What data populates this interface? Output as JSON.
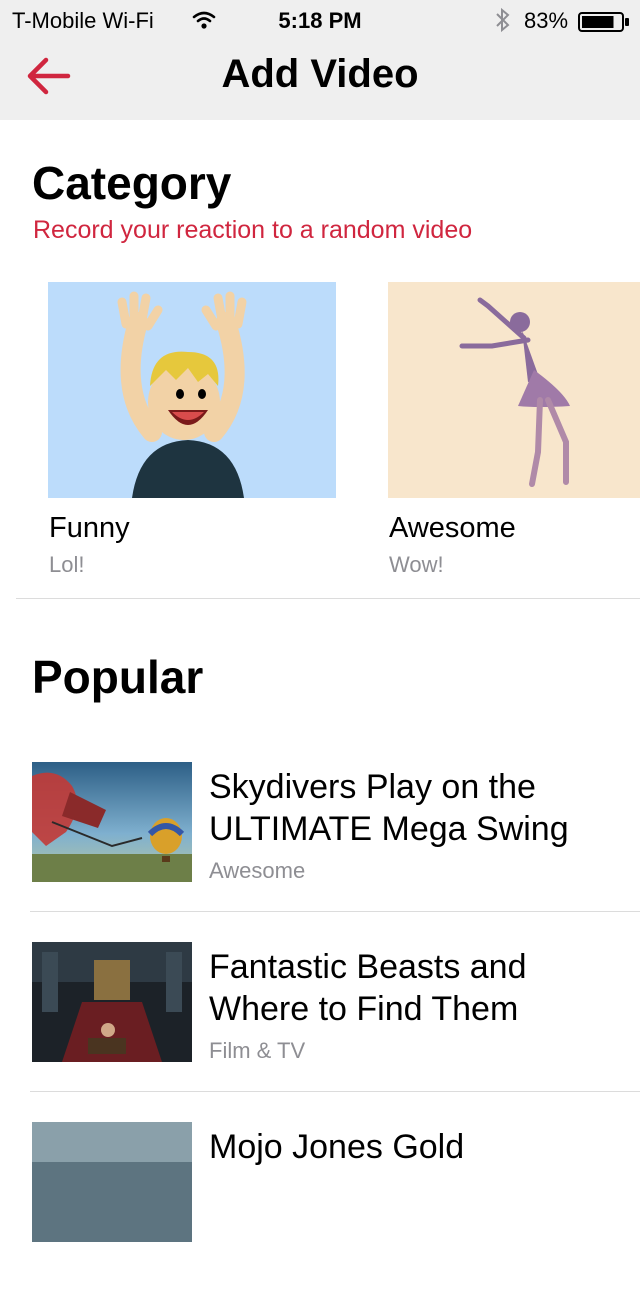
{
  "status_bar": {
    "carrier": "T-Mobile Wi-Fi",
    "time": "5:18 PM",
    "battery_percent": "83%",
    "battery_level": 0.83
  },
  "nav": {
    "title": "Add Video",
    "back_icon": "arrow-left-icon",
    "accent_color": "#d0263f"
  },
  "category": {
    "title": "Category",
    "subtitle": "Record your reaction to a random video",
    "items": [
      {
        "name": "Funny",
        "description": "Lol!"
      },
      {
        "name": "Awesome",
        "description": "Wow!"
      }
    ]
  },
  "popular": {
    "title": "Popular",
    "items": [
      {
        "title": "Skydivers Play on the ULTIMATE Mega Swing",
        "category": "Awesome"
      },
      {
        "title": "Fantastic Beasts and Where to Find Them",
        "category": "Film & TV"
      },
      {
        "title": "Mojo Jones Gold",
        "category": ""
      }
    ]
  }
}
